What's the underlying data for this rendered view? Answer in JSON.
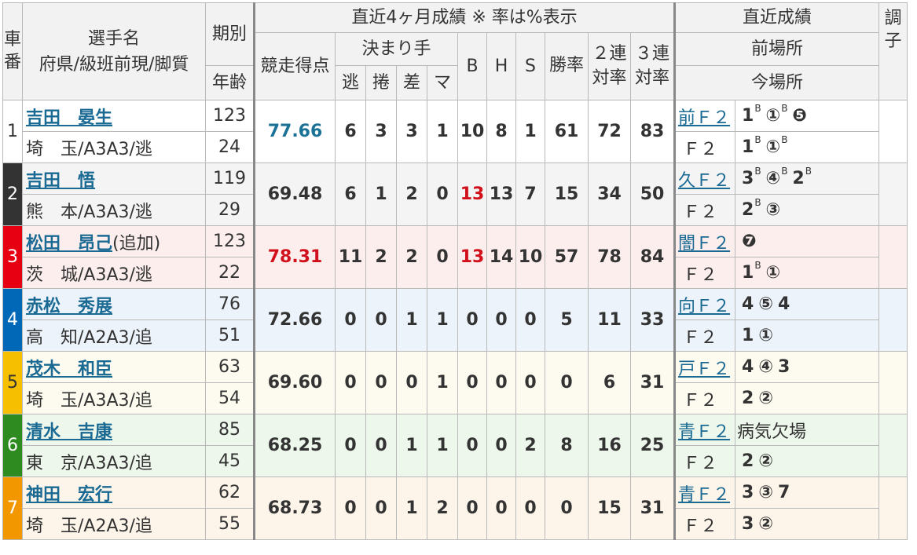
{
  "header": {
    "car_no": "車番",
    "racer_name": "選手名",
    "racer_sub": "府県/級班前現/脚質",
    "term": "期別",
    "age": "年齢",
    "recent4m": "直近4ヶ月成績 ※ 率は%表示",
    "score": "競走得点",
    "kimarite": "決まり手",
    "k_nige": "逃",
    "k_makuri": "捲",
    "k_sashi": "差",
    "k_ma": "マ",
    "b": "B",
    "h": "H",
    "s": "S",
    "win_rate": "勝率",
    "ren2": "２連対率",
    "ren3": "３連対率",
    "recent_results": "直近成績",
    "prev_venue": "前場所",
    "cur_venue": "今場所",
    "condition": "調子"
  },
  "colors": {
    "car_1": "#ffffff",
    "car_2": "#333333",
    "car_3": "#e60012",
    "car_4": "#0068b7",
    "car_5": "#f6c000",
    "car_6": "#2e8b20",
    "car_7": "#f39700",
    "row_1": "#ffffff",
    "row_2": "#f4f4f4",
    "row_3": "#fdeeee",
    "row_4": "#edf3fa",
    "row_5": "#fdfbef",
    "row_6": "#eef7ec",
    "row_7": "#fef5ea"
  },
  "racers": [
    {
      "car": "1",
      "name": "吉田　晏生",
      "note": "",
      "pref": "埼　玉/A3A3/逃",
      "term": "123",
      "age": "24",
      "score": "77.66",
      "score_color": "teal",
      "nige": "6",
      "makuri": "3",
      "sashi": "3",
      "ma": "1",
      "b": "10",
      "b_red": false,
      "h": "8",
      "s": "1",
      "win": "61",
      "r2": "72",
      "r3": "83",
      "prev_label": "前Ｆ２",
      "prev": [
        {
          "t": "1",
          "sup": "B"
        },
        {
          "t": "①",
          "sup": "B"
        },
        {
          "t": "❺",
          "sup": ""
        }
      ],
      "cur_label": "Ｆ２",
      "cur": [
        {
          "t": "1",
          "sup": "B"
        },
        {
          "t": "①",
          "sup": "B"
        }
      ]
    },
    {
      "car": "2",
      "name": "吉田　悟",
      "note": "",
      "pref": "熊　本/A3A3/逃",
      "term": "119",
      "age": "29",
      "score": "69.48",
      "score_color": "",
      "nige": "6",
      "makuri": "1",
      "sashi": "2",
      "ma": "0",
      "b": "13",
      "b_red": true,
      "h": "13",
      "s": "7",
      "win": "15",
      "r2": "34",
      "r3": "50",
      "prev_label": "久Ｆ２",
      "prev": [
        {
          "t": "3",
          "sup": "B"
        },
        {
          "t": "④",
          "sup": "B"
        },
        {
          "t": "2",
          "sup": "B"
        }
      ],
      "cur_label": "Ｆ２",
      "cur": [
        {
          "t": "2",
          "sup": "B"
        },
        {
          "t": "③",
          "sup": ""
        }
      ]
    },
    {
      "car": "3",
      "name": "松田　昂己",
      "note": "(追加)",
      "pref": "茨　城/A3A3/逃",
      "term": "123",
      "age": "22",
      "score": "78.31",
      "score_color": "red",
      "nige": "11",
      "makuri": "2",
      "sashi": "2",
      "ma": "0",
      "b": "13",
      "b_red": true,
      "h": "14",
      "s": "10",
      "win": "57",
      "r2": "78",
      "r3": "84",
      "prev_label": "闇Ｆ２",
      "prev": [
        {
          "t": "❼",
          "sup": ""
        }
      ],
      "cur_label": "Ｆ２",
      "cur": [
        {
          "t": "1",
          "sup": "B"
        },
        {
          "t": "①",
          "sup": ""
        }
      ]
    },
    {
      "car": "4",
      "name": "赤松　秀展",
      "note": "",
      "pref": "高　知/A2A3/追",
      "term": "76",
      "age": "51",
      "score": "72.66",
      "score_color": "",
      "nige": "0",
      "makuri": "0",
      "sashi": "1",
      "ma": "1",
      "b": "0",
      "b_red": false,
      "h": "0",
      "s": "0",
      "win": "5",
      "r2": "11",
      "r3": "33",
      "prev_label": "向Ｆ２",
      "prev": [
        {
          "t": "4",
          "sup": ""
        },
        {
          "t": "⑤",
          "sup": ""
        },
        {
          "t": "4",
          "sup": ""
        }
      ],
      "cur_label": "Ｆ２",
      "cur": [
        {
          "t": "1",
          "sup": ""
        },
        {
          "t": "①",
          "sup": ""
        }
      ]
    },
    {
      "car": "5",
      "name": "茂木　和臣",
      "note": "",
      "pref": "埼　玉/A3A3/追",
      "term": "63",
      "age": "54",
      "score": "69.60",
      "score_color": "",
      "nige": "0",
      "makuri": "0",
      "sashi": "0",
      "ma": "1",
      "b": "0",
      "b_red": false,
      "h": "0",
      "s": "0",
      "win": "0",
      "r2": "6",
      "r3": "31",
      "prev_label": "戸Ｆ２",
      "prev": [
        {
          "t": "4",
          "sup": ""
        },
        {
          "t": "④",
          "sup": ""
        },
        {
          "t": "3",
          "sup": ""
        }
      ],
      "cur_label": "Ｆ２",
      "cur": [
        {
          "t": "2",
          "sup": ""
        },
        {
          "t": "②",
          "sup": ""
        }
      ]
    },
    {
      "car": "6",
      "name": "清水　吉康",
      "note": "",
      "pref": "東　京/A3A3/追",
      "term": "85",
      "age": "45",
      "score": "68.25",
      "score_color": "",
      "nige": "0",
      "makuri": "0",
      "sashi": "1",
      "ma": "1",
      "b": "0",
      "b_red": false,
      "h": "0",
      "s": "2",
      "win": "8",
      "r2": "16",
      "r3": "25",
      "prev_label": "青Ｆ２",
      "prev_text": "病気欠場",
      "prev": [],
      "cur_label": "Ｆ２",
      "cur": [
        {
          "t": "2",
          "sup": ""
        },
        {
          "t": "②",
          "sup": ""
        }
      ]
    },
    {
      "car": "7",
      "name": "神田　宏行",
      "note": "",
      "pref": "埼　玉/A2A3/追",
      "term": "62",
      "age": "55",
      "score": "68.73",
      "score_color": "",
      "nige": "0",
      "makuri": "0",
      "sashi": "1",
      "ma": "2",
      "b": "0",
      "b_red": false,
      "h": "0",
      "s": "0",
      "win": "0",
      "r2": "15",
      "r3": "31",
      "prev_label": "青Ｆ２",
      "prev": [
        {
          "t": "3",
          "sup": ""
        },
        {
          "t": "③",
          "sup": ""
        },
        {
          "t": "7",
          "sup": ""
        }
      ],
      "cur_label": "Ｆ２",
      "cur": [
        {
          "t": "3",
          "sup": ""
        },
        {
          "t": "②",
          "sup": ""
        }
      ]
    }
  ]
}
